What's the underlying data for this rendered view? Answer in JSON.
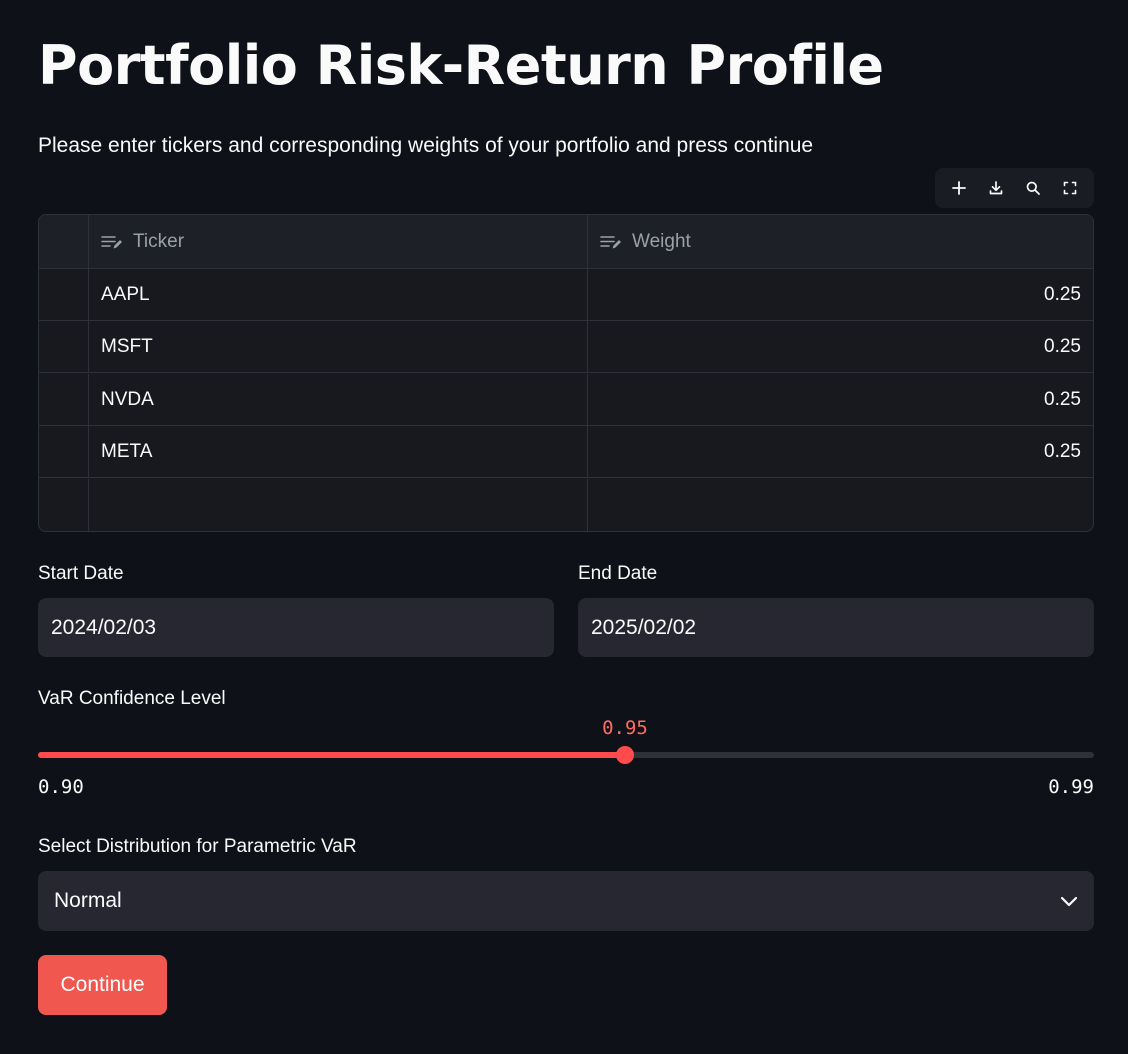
{
  "page": {
    "title": "Portfolio Risk-Return Profile",
    "subtitle": "Please enter tickers and corresponding weights of your portfolio and press continue"
  },
  "toolbar": {
    "icons": [
      "add-row-icon",
      "download-icon",
      "search-icon",
      "fullscreen-icon"
    ]
  },
  "table": {
    "columns": [
      "Ticker",
      "Weight"
    ],
    "rows": [
      {
        "ticker": "AAPL",
        "weight": "0.25"
      },
      {
        "ticker": "MSFT",
        "weight": "0.25"
      },
      {
        "ticker": "NVDA",
        "weight": "0.25"
      },
      {
        "ticker": "META",
        "weight": "0.25"
      },
      {
        "ticker": "",
        "weight": ""
      }
    ]
  },
  "dates": {
    "start_label": "Start Date",
    "start_value": "2024/02/03",
    "end_label": "End Date",
    "end_value": "2025/02/02"
  },
  "slider": {
    "label": "VaR Confidence Level",
    "value": "0.95",
    "min": "0.90",
    "max": "0.99",
    "fraction": 0.556
  },
  "distribution": {
    "label": "Select Distribution for Parametric VaR",
    "selected": "Normal"
  },
  "actions": {
    "continue_label": "Continue"
  },
  "colors": {
    "background": "#0e1117",
    "accent": "#ff4b4b",
    "button": "#f0574f",
    "input_bg": "#262730"
  }
}
